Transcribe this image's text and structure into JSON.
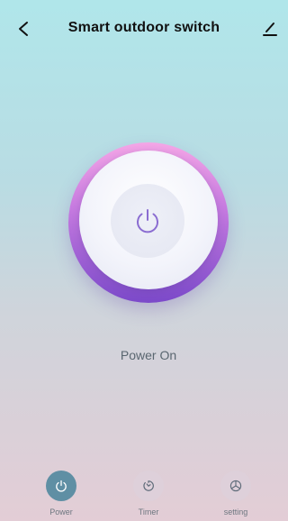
{
  "header": {
    "title": "Smart outdoor switch",
    "back_icon": "chevron-left-icon",
    "edit_icon": "pencil-icon"
  },
  "power": {
    "state": "on",
    "status_text": "Power On",
    "icon": "power-icon",
    "colors": {
      "ring_top": "#f4a6e6",
      "ring_bottom": "#7b49c9",
      "icon": "#8a6cd1"
    }
  },
  "tabbar": {
    "tabs": [
      {
        "label": "Power",
        "icon": "power-icon",
        "active": true
      },
      {
        "label": "Timer",
        "icon": "timer-icon",
        "active": false
      },
      {
        "label": "setting",
        "icon": "settings-icon",
        "active": false
      }
    ],
    "active_color": "#5f8fa4"
  }
}
